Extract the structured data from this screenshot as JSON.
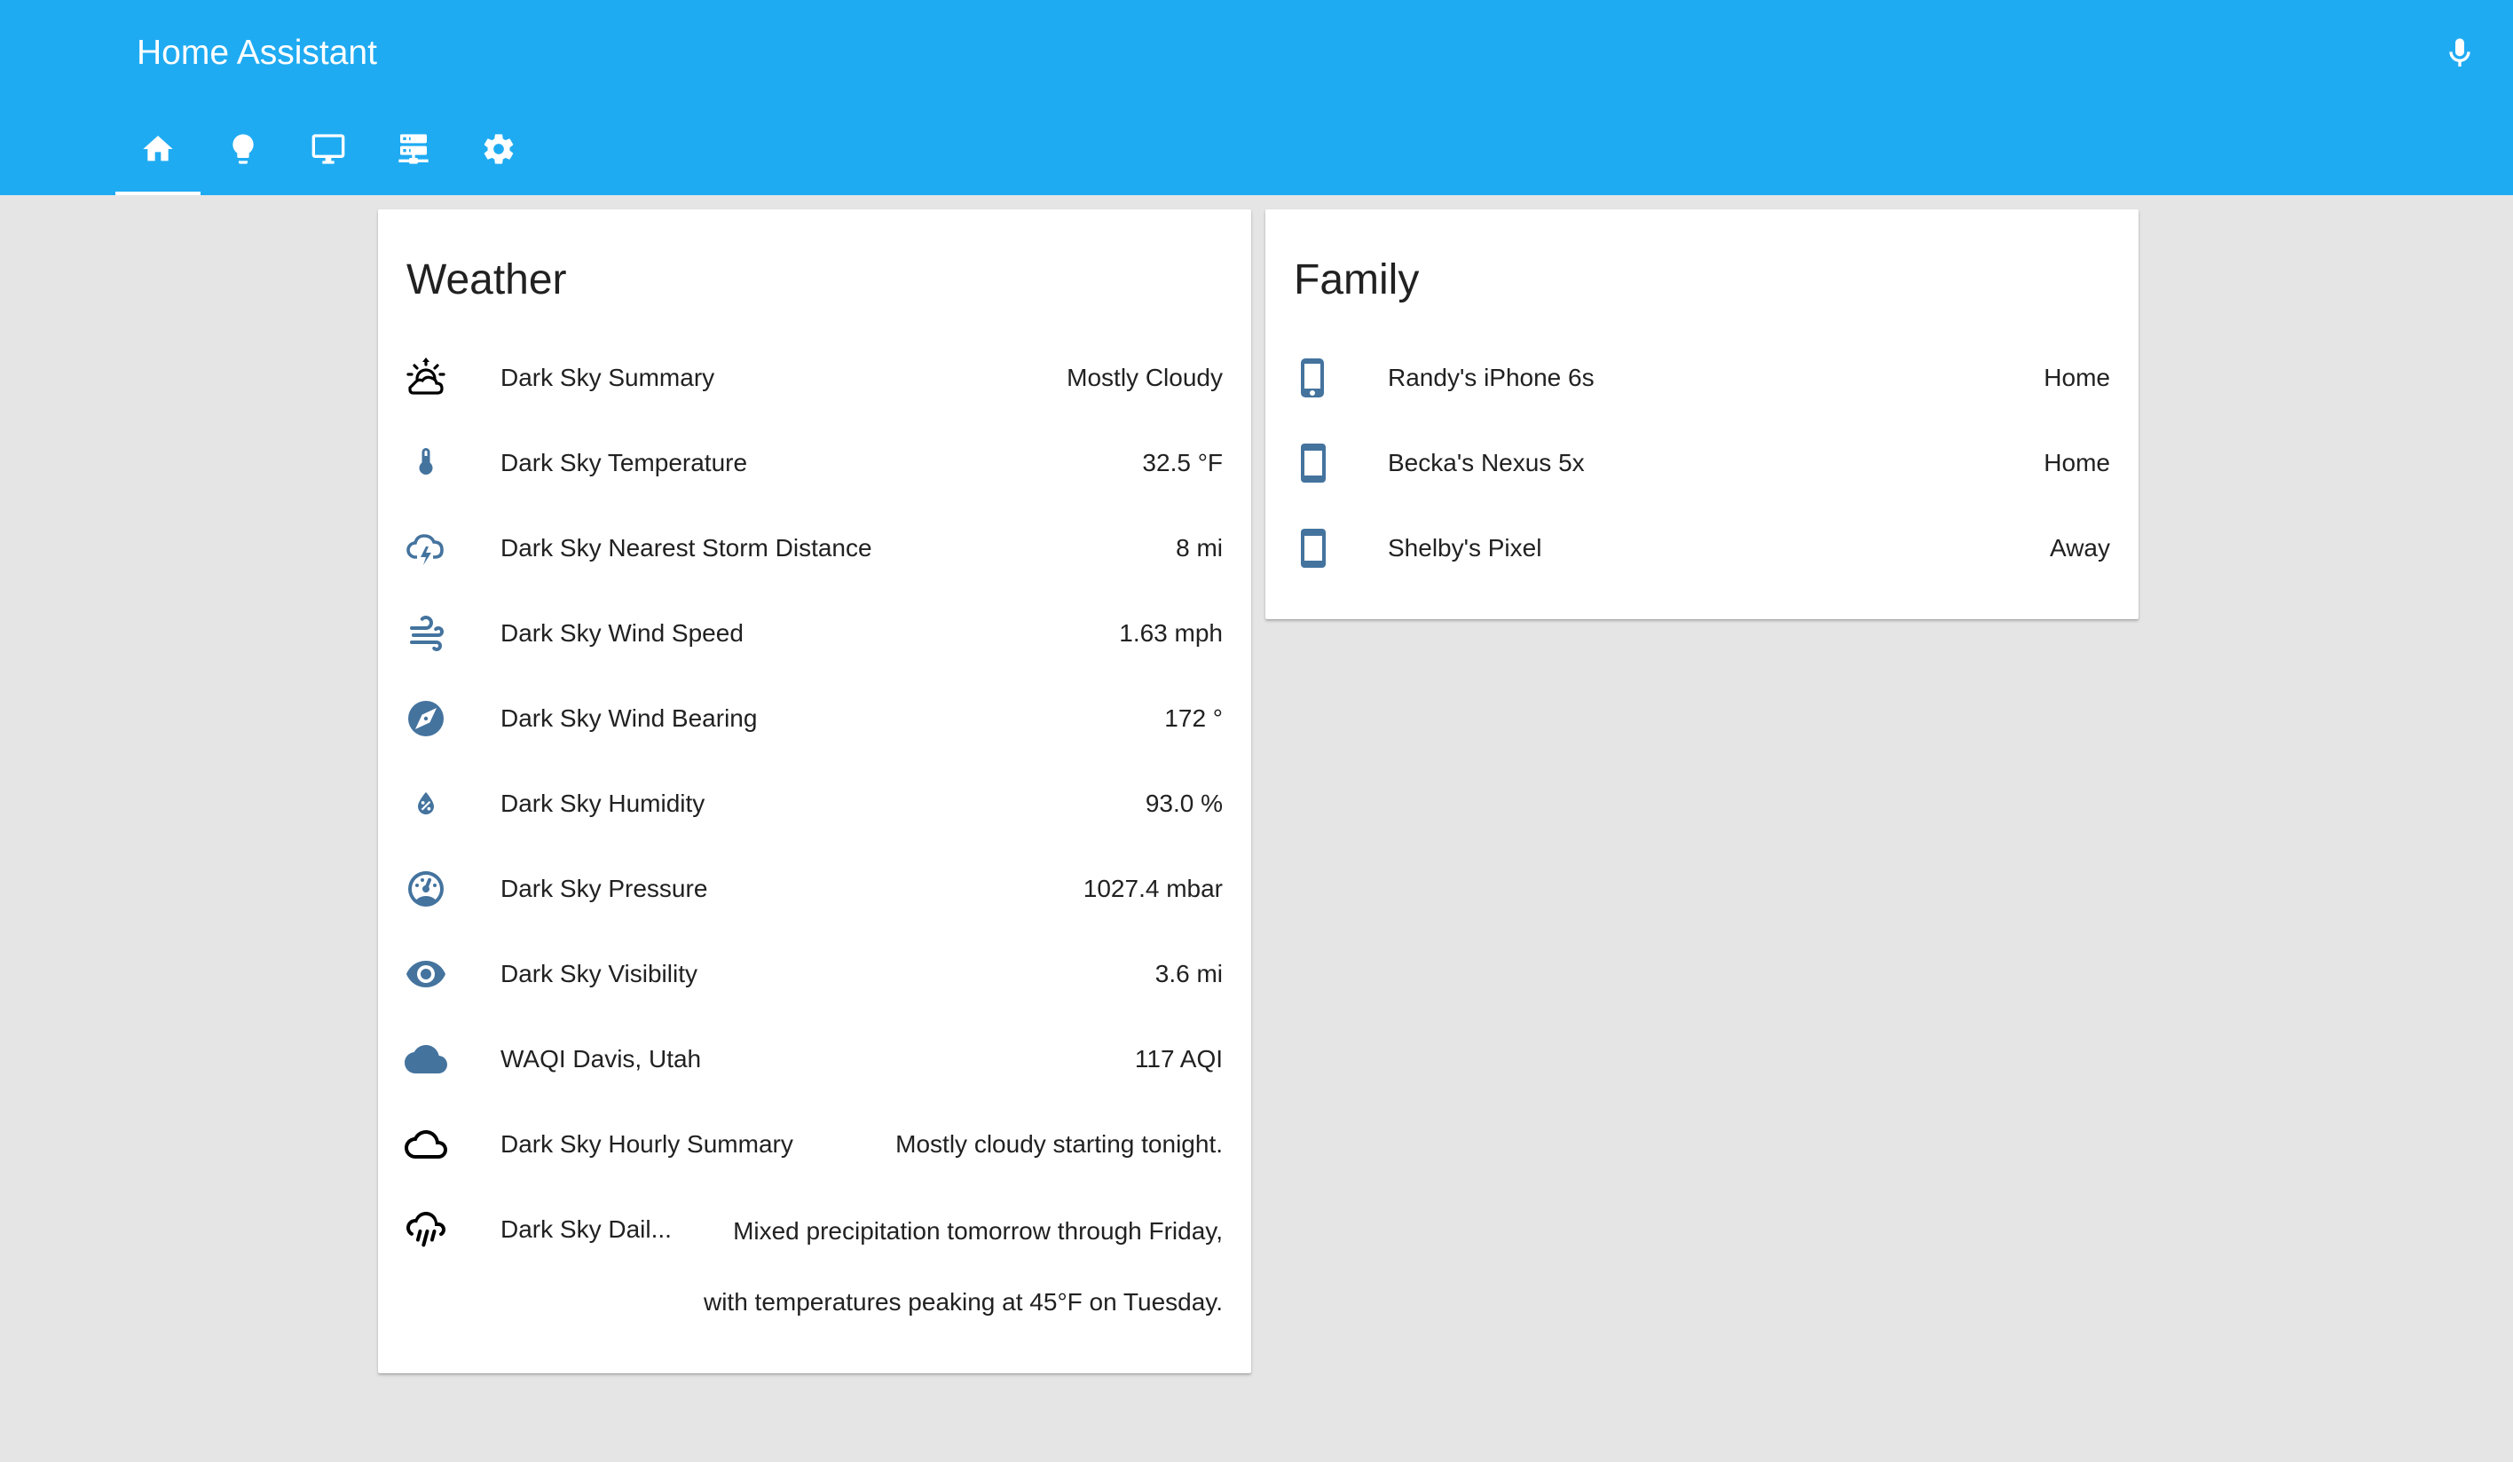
{
  "app": {
    "title": "Home Assistant"
  },
  "header": {
    "background_color": "#1fabf2",
    "mic_icon": "microphone-icon",
    "tabs": [
      {
        "name": "home",
        "icon": "home-icon",
        "active": true
      },
      {
        "name": "lights",
        "icon": "lightbulb-icon",
        "active": false
      },
      {
        "name": "media",
        "icon": "monitor-icon",
        "active": false
      },
      {
        "name": "server",
        "icon": "server-network-icon",
        "active": false
      },
      {
        "name": "settings",
        "icon": "gear-icon",
        "active": false
      }
    ]
  },
  "weather_card": {
    "title": "Weather",
    "rows": [
      {
        "name": "Dark Sky Summary",
        "value": "Mostly Cloudy",
        "icon": "weather-sunset-cloudy-icon"
      },
      {
        "name": "Dark Sky Temperature",
        "value": "32.5 °F",
        "icon": "thermometer-icon"
      },
      {
        "name": "Dark Sky Nearest Storm Distance",
        "value": "8 mi",
        "icon": "weather-lightning-icon"
      },
      {
        "name": "Dark Sky Wind Speed",
        "value": "1.63 mph",
        "icon": "weather-windy-icon"
      },
      {
        "name": "Dark Sky Wind Bearing",
        "value": "172 °",
        "icon": "compass-icon"
      },
      {
        "name": "Dark Sky Humidity",
        "value": "93.0 %",
        "icon": "water-percent-icon"
      },
      {
        "name": "Dark Sky Pressure",
        "value": "1027.4 mbar",
        "icon": "gauge-icon"
      },
      {
        "name": "Dark Sky Visibility",
        "value": "3.6 mi",
        "icon": "eye-icon"
      },
      {
        "name": "WAQI Davis, Utah",
        "value": "117 AQI",
        "icon": "cloud-icon"
      },
      {
        "name": "Dark Sky Hourly Summary",
        "value": "Mostly cloudy starting tonight.",
        "icon": "cloud-outline-icon"
      },
      {
        "name": "Dark Sky Dail...",
        "value_line1": "Mixed precipitation tomorrow through Friday,",
        "value_line2": "with temperatures peaking at 45°F on Tuesday.",
        "icon": "weather-pouring-icon"
      }
    ]
  },
  "family_card": {
    "title": "Family",
    "rows": [
      {
        "name": "Randy's iPhone 6s",
        "value": "Home",
        "icon": "cellphone-iphone-icon"
      },
      {
        "name": "Becka's Nexus 5x",
        "value": "Home",
        "icon": "cellphone-icon"
      },
      {
        "name": "Shelby's Pixel",
        "value": "Away",
        "icon": "cellphone-icon"
      }
    ]
  },
  "colors": {
    "icon_blue": "#44739e",
    "icon_black": "#000000",
    "background": "#e5e5e5"
  }
}
